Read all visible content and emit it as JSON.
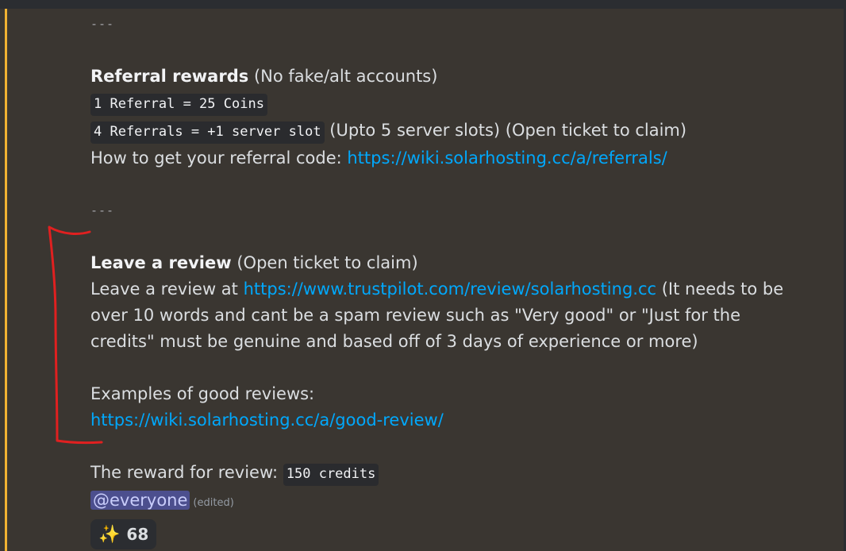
{
  "separator": "---",
  "referral": {
    "title": "Referral rewards",
    "note": "(No fake/alt accounts)",
    "code1": "1 Referral = 25 Coins",
    "code2": "4 Referrals = +1 server slot",
    "code2_note": "(Upto 5 server slots) (Open ticket to claim)",
    "howto_text": "How to get your referral code:",
    "howto_link": "https://wiki.solarhosting.cc/a/referrals/"
  },
  "review": {
    "title": "Leave a review",
    "note": "(Open ticket to claim)",
    "leave_text": "Leave a review at",
    "leave_link": "https://www.trustpilot.com/review/solarhosting.cc",
    "rules": "(It needs to be over 10 words and cant be a spam review such as \"Very good\" or \"Just for the credits\" must be genuine and based off of 3 days of experience or more)",
    "examples_label": "Examples of good reviews:",
    "examples_link": "https://wiki.solarhosting.cc/a/good-review/"
  },
  "reward": {
    "text": "The reward for review:",
    "code": "150 credits"
  },
  "mention": "@everyone",
  "edited": "(edited)",
  "reaction": {
    "icon": "sparkles-icon",
    "emoji": "✨",
    "count": "68"
  },
  "colors": {
    "accent_bar": "#f0b232",
    "link": "#00a8fc",
    "mention_bg": "#4c4f8e",
    "annotation": "#e02020"
  }
}
